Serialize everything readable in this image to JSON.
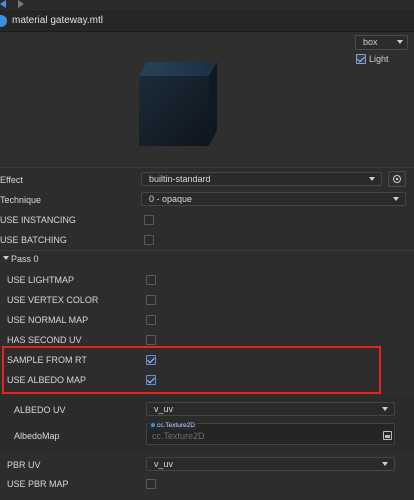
{
  "title": "material gateway.mtl",
  "preview": {
    "shape": "box",
    "light_label": "Light",
    "light_checked": true
  },
  "effect": {
    "label": "Effect",
    "value": "builtin-standard"
  },
  "technique": {
    "label": "Technique",
    "value": "0 - opaque"
  },
  "use_instancing": {
    "label": "USE INSTANCING",
    "checked": false
  },
  "use_batching": {
    "label": "USE BATCHING",
    "checked": false
  },
  "pass": {
    "label": "Pass 0",
    "defines": [
      {
        "label": "USE LIGHTMAP",
        "checked": false
      },
      {
        "label": "USE VERTEX COLOR",
        "checked": false
      },
      {
        "label": "USE NORMAL MAP",
        "checked": false
      },
      {
        "label": "HAS SECOND UV",
        "checked": false
      },
      {
        "label": "SAMPLE FROM RT",
        "checked": true
      },
      {
        "label": "USE ALBEDO MAP",
        "checked": true
      }
    ],
    "albedo_uv": {
      "label": "ALBEDO UV",
      "value": "v_uv"
    },
    "albedo_map": {
      "label": "AlbedoMap",
      "type_tag": "cc.Texture2D",
      "placeholder": "cc.Texture2D"
    },
    "pbr_uv": {
      "label": "PBR UV",
      "value": "v_uv"
    },
    "use_pbr_map": {
      "label": "USE PBR MAP",
      "checked": false
    }
  }
}
